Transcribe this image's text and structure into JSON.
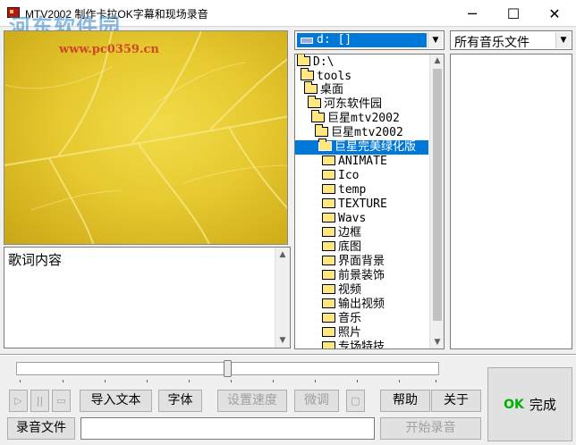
{
  "window": {
    "title": "MTV2002 制作卡拉OK字幕和现场录音",
    "controls": {
      "minimize": "─",
      "maximize": "☐",
      "close": "✕"
    }
  },
  "watermark": {
    "site_name": "河东软件园",
    "url": "www.pc0359.cn"
  },
  "lyrics": {
    "text": "歌词内容"
  },
  "drive_combo": {
    "value": "d: []"
  },
  "filter_combo": {
    "value": "所有音乐文件"
  },
  "folder_tree": [
    {
      "label": "D:\\",
      "mono": true
    },
    {
      "label": "tools",
      "mono": true
    },
    {
      "label": "桌面",
      "mono": false
    },
    {
      "label": "河东软件园",
      "mono": false
    },
    {
      "label": "巨星mtv2002",
      "mono": true
    },
    {
      "label": "巨星mtv2002",
      "mono": true
    },
    {
      "label": "巨星完美绿化版",
      "mono": false,
      "selected": true
    },
    {
      "label": "ANIMATE",
      "mono": true
    },
    {
      "label": "Ico",
      "mono": true
    },
    {
      "label": "temp",
      "mono": true
    },
    {
      "label": "TEXTURE",
      "mono": true
    },
    {
      "label": "Wavs",
      "mono": true
    },
    {
      "label": "边框",
      "mono": false
    },
    {
      "label": "底图",
      "mono": false
    },
    {
      "label": "界面背景",
      "mono": false
    },
    {
      "label": "前景装饰",
      "mono": false
    },
    {
      "label": "视频",
      "mono": false
    },
    {
      "label": "输出视频",
      "mono": false
    },
    {
      "label": "音乐",
      "mono": false
    },
    {
      "label": "照片",
      "mono": false
    },
    {
      "label": "专场特技",
      "mono": false
    }
  ],
  "progress": {
    "position_fraction": 0.5
  },
  "buttons": {
    "play": "▷",
    "pause": "||",
    "stop": "▭",
    "import_text": "导入文本",
    "font": "字体",
    "set_speed": "设置速度",
    "fine_tune": "微调",
    "small": "▢",
    "help": "帮助",
    "about": "关于",
    "ok_mark": "OK",
    "finish": "完成",
    "record_file": "录音文件",
    "start_record": "开始录音"
  },
  "icons": {
    "scroll_up": "▲",
    "scroll_down": "▼",
    "combo_arrow": "▼"
  }
}
